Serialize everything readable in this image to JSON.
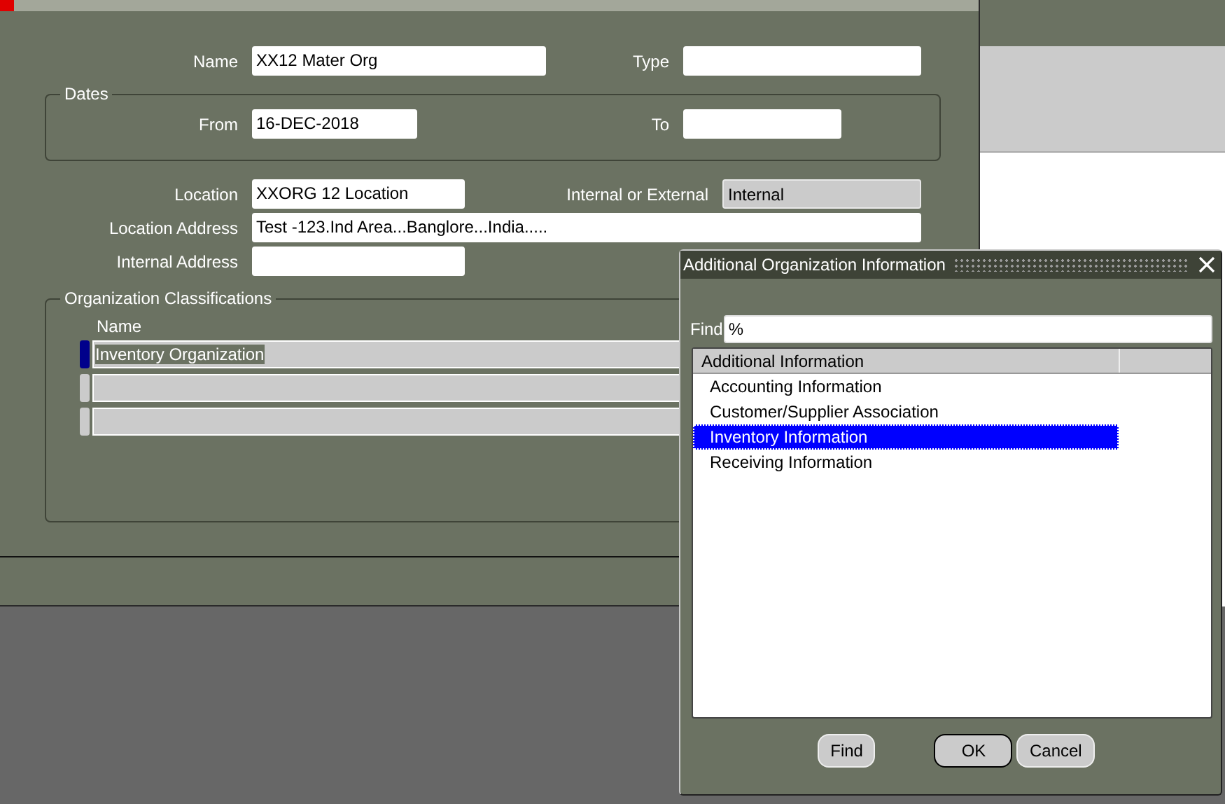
{
  "organization_window": {
    "name": {
      "label": "Name",
      "value": "XX12 Mater Org"
    },
    "type": {
      "label": "Type"
    },
    "dates": {
      "title": "Dates",
      "from": {
        "label": "From",
        "value": "16-DEC-2018"
      },
      "to": {
        "label": "To"
      }
    },
    "location": {
      "label": "Location",
      "value": "XXORG 12 Location"
    },
    "internal_or_external": {
      "label": "Internal or External",
      "value": "Internal",
      "read_only": true
    },
    "location_address": {
      "label": "Location Address",
      "value": "Test -123.Ind Area...Banglore...India....."
    },
    "internal_address": {
      "label": "Internal Address"
    },
    "classifications": {
      "title": "Organization Classifications",
      "column": "Name",
      "rows": [
        {
          "name": "Inventory Organization",
          "selected": true
        },
        {
          "selected": false
        },
        {
          "selected": false
        }
      ]
    }
  },
  "dialog": {
    "title": "Additional Organization Information",
    "find": {
      "label": "Find",
      "value": "%"
    },
    "list": {
      "column": "Additional Information",
      "items": [
        {
          "label": "Accounting Information",
          "selected": false
        },
        {
          "label": "Customer/Supplier Association",
          "selected": false
        },
        {
          "label": "Inventory Information",
          "selected": true
        },
        {
          "label": "Receiving Information",
          "selected": false
        }
      ]
    },
    "buttons": [
      {
        "label": "Find",
        "default": false
      },
      {
        "label": "OK",
        "default": true
      },
      {
        "label": "Cancel",
        "default": false
      }
    ]
  }
}
